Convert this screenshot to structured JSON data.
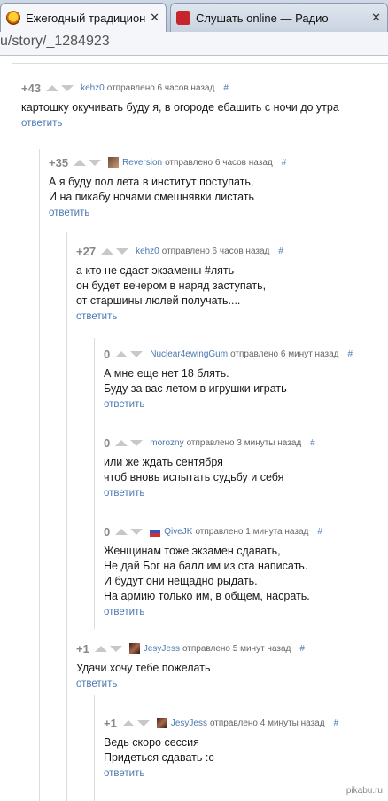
{
  "browser": {
    "tabs": [
      {
        "title": "Ежегодный традиционны",
        "close": "✕"
      },
      {
        "title": "Слушать online — Радио",
        "close": "✕"
      }
    ],
    "url": "u/story/_1284923"
  },
  "comments": [
    {
      "rating": "+43",
      "user": "kehz0",
      "sent": "отправлено 6 часов назад",
      "hash": "#",
      "lines": [
        "картошку окучивать буду я, в огороде ебашить с ночи до утра"
      ],
      "reply": "ответить"
    },
    {
      "rating": "+35",
      "user": "Reversion",
      "sent": "отправлено 6 часов назад",
      "hash": "#",
      "lines": [
        "А я буду пол лета в институт поступать,",
        "И на пикабу ночами смешнявки листать"
      ],
      "reply": "ответить"
    },
    {
      "rating": "+27",
      "user": "kehz0",
      "sent": "отправлено 6 часов назад",
      "hash": "#",
      "lines": [
        "а кто не сдаст экзамены #лять",
        "он будет вечером в наряд заступать,",
        "от старшины люлей получать...."
      ],
      "reply": "ответить"
    },
    {
      "rating": "0",
      "user": "Nuclear4ewingGum",
      "sent": "отправлено 6 минут назад",
      "hash": "#",
      "lines": [
        "А мне еще нет 18 блять.",
        "Буду за вас летом в игрушки играть"
      ],
      "reply": "ответить"
    },
    {
      "rating": "0",
      "user": "morozny",
      "sent": "отправлено 3 минуты назад",
      "hash": "#",
      "lines": [
        "или же ждать сентября",
        "чтоб вновь испытать судьбу и себя"
      ],
      "reply": "ответить"
    },
    {
      "rating": "0",
      "user": "QiveJK",
      "sent": "отправлено 1 минута назад",
      "hash": "#",
      "lines": [
        "Женщинам тоже экзамен сдавать,",
        "Не дай Бог на балл им из ста написать.",
        "И будут они нещадно рыдать.",
        "На армию только им, в общем, насрать."
      ],
      "reply": "ответить"
    },
    {
      "rating": "+1",
      "user": "JesyJess",
      "sent": "отправлено 5 минут назад",
      "hash": "#",
      "lines": [
        "Удачи хочу тебе пожелать"
      ],
      "reply": "ответить"
    },
    {
      "rating": "+1",
      "user": "JesyJess",
      "sent": "отправлено 4 минуты назад",
      "hash": "#",
      "lines": [
        "Ведь скоро сессия",
        "Придеться сдавать :с"
      ],
      "reply": "ответить"
    }
  ],
  "watermark": "pikabu.ru"
}
